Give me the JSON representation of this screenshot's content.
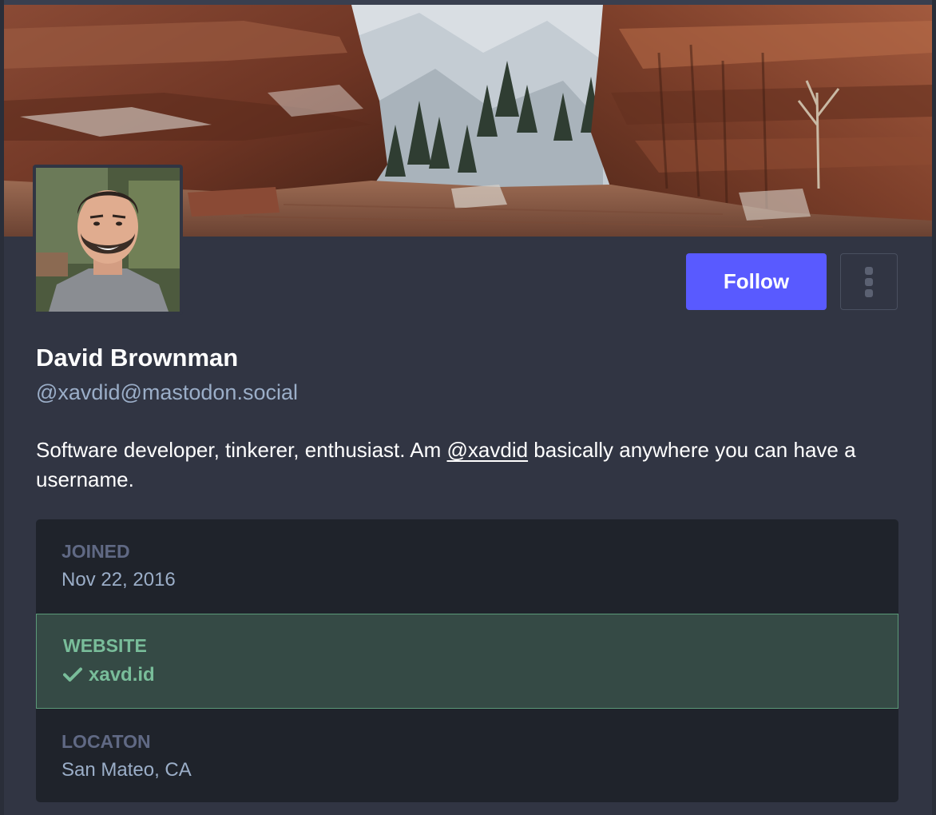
{
  "profile": {
    "display_name": "David Brownman",
    "handle": "@xavdid@mastodon.social",
    "bio": {
      "before": "Software developer, tinkerer, enthusiast. Am ",
      "mention": "@xavdid",
      "after": " basically anywhere you can have a username."
    }
  },
  "actions": {
    "follow_label": "Follow",
    "menu_icon": "vertical-ellipsis-icon"
  },
  "fields": {
    "joined": {
      "label": "JOINED",
      "value": "Nov 22, 2016"
    },
    "website": {
      "label": "WEBSITE",
      "value": "xavd.id",
      "verified": true,
      "icon": "check-icon"
    },
    "location": {
      "label": "LOCATON",
      "value": "San Mateo, CA"
    }
  },
  "colors": {
    "background": "#313543",
    "accent": "#595aff",
    "verified": "#79bd9a",
    "verified_bg": "#354a45",
    "muted": "#9baec8",
    "label": "#606984",
    "fields_bg": "#1f232b"
  }
}
